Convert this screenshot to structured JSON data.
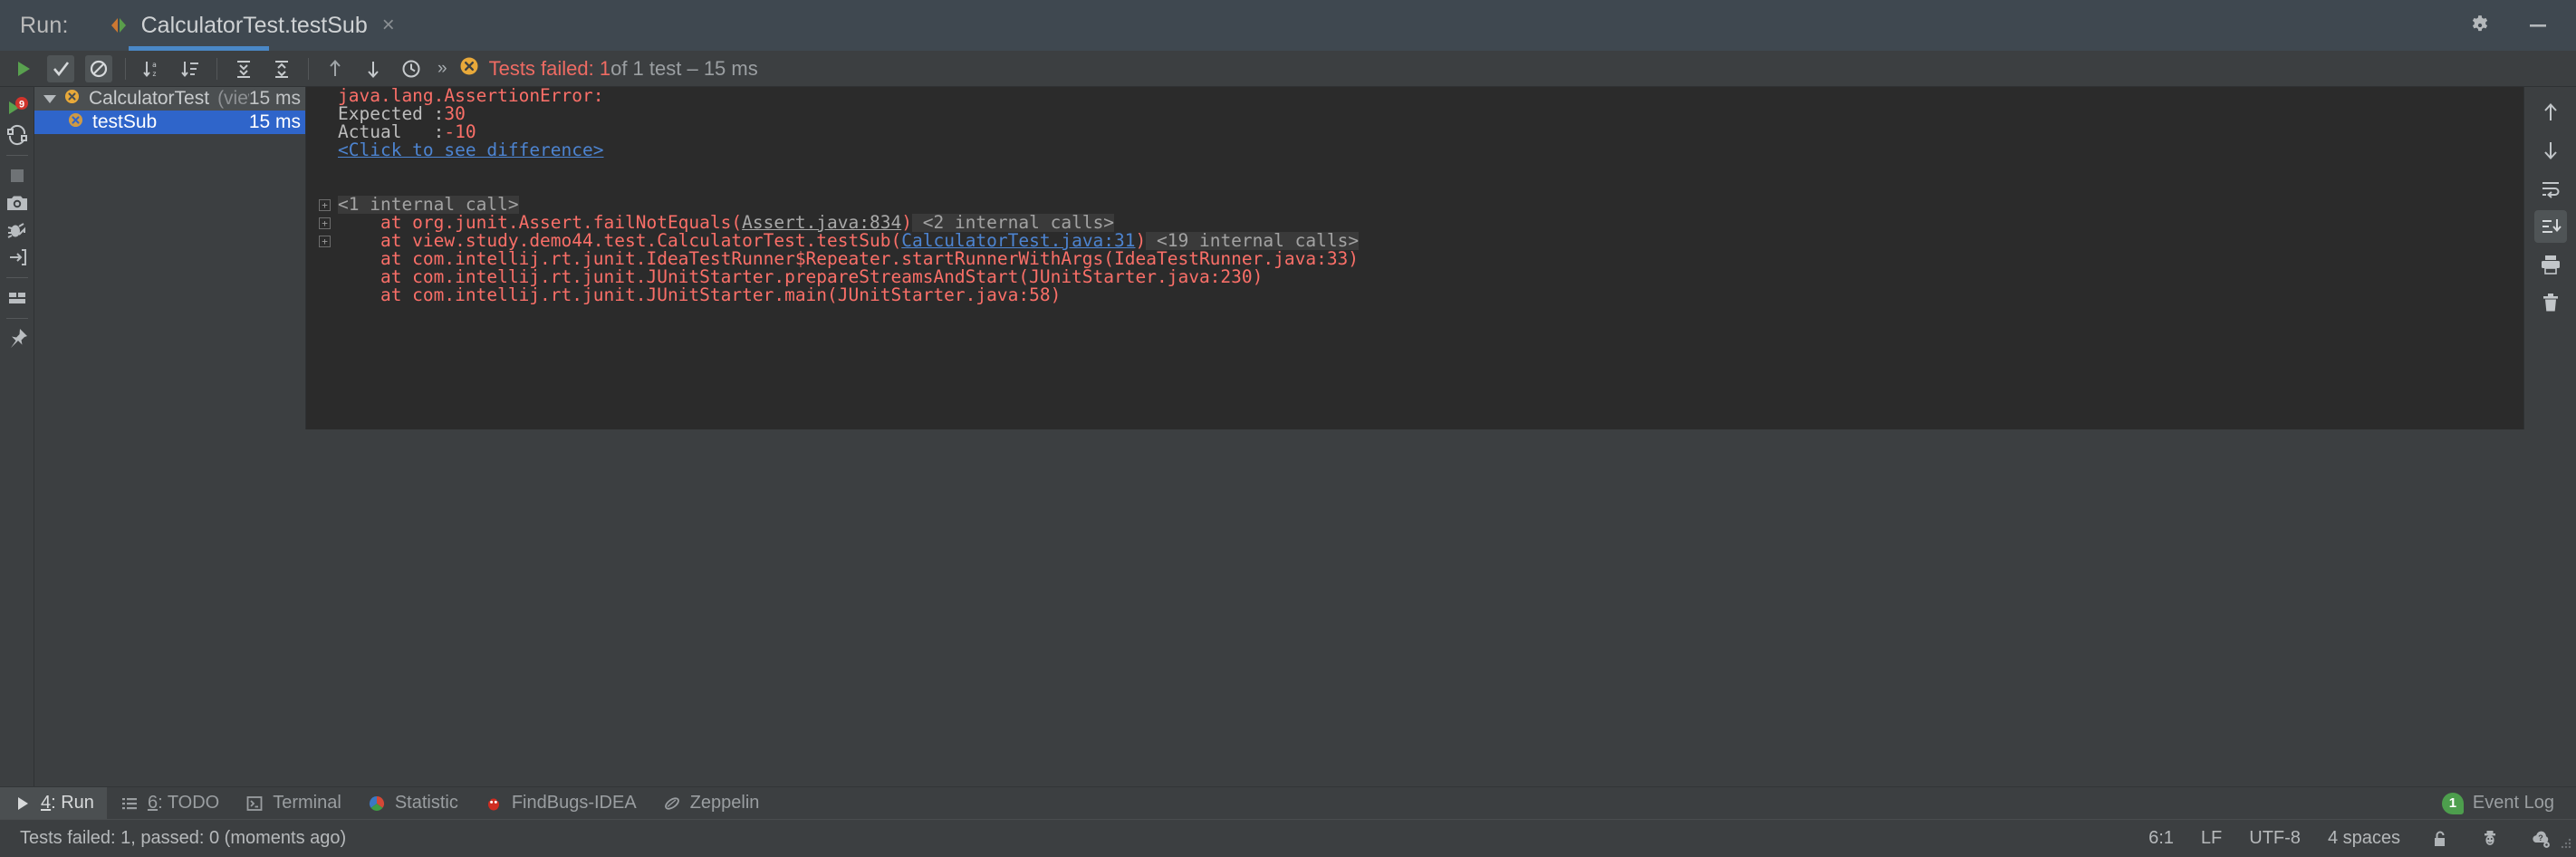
{
  "titlebar": {
    "run_label": "Run:",
    "tab_title": "CalculatorTest.testSub",
    "close_glyph": "×",
    "settings_icon": "gear-icon",
    "minimize_icon": "minimize-icon"
  },
  "toolbar": {
    "icons": [
      {
        "name": "rerun-tests-button",
        "label": "Rerun"
      },
      {
        "name": "show-passed-toggle",
        "label": "Show Passed"
      },
      {
        "name": "hide-ignored-toggle",
        "label": "Hide Ignored"
      },
      {
        "name": "sort-alphabetically-button",
        "label": "Sort Alphabetically"
      },
      {
        "name": "sort-by-duration-button",
        "label": "Sort by Duration"
      },
      {
        "name": "expand-all-button",
        "label": "Expand All"
      },
      {
        "name": "collapse-all-button",
        "label": "Collapse All"
      },
      {
        "name": "previous-failed-test-button",
        "label": "Previous Failed Test"
      },
      {
        "name": "next-failed-test-button",
        "label": "Next Failed Test"
      },
      {
        "name": "test-history-button",
        "label": "Test History"
      },
      {
        "name": "more-options-button",
        "label": "More"
      }
    ],
    "chevrons": "»",
    "status_fail": "Tests failed: 1",
    "status_rest": " of 1 test – 15 ms"
  },
  "left_gutter": {
    "icons": [
      {
        "name": "rerun-failed-tests-icon",
        "label": "Rerun Failed Tests"
      },
      {
        "name": "rerun-automatically-icon",
        "label": "Rerun Automatically"
      },
      {
        "name": "stop-icon",
        "label": "Stop"
      },
      {
        "name": "screenshot-icon",
        "label": "Screenshot"
      },
      {
        "name": "debug-icon",
        "label": "Debug"
      },
      {
        "name": "import-tests-icon",
        "label": "Import Test Results"
      },
      {
        "name": "layout-icon",
        "label": "Layout Settings"
      },
      {
        "name": "pin-tab-icon",
        "label": "Pin Tab"
      }
    ]
  },
  "tree": {
    "root": {
      "name": "CalculatorTest",
      "package": "(view.study.dem",
      "duration": "15 ms",
      "status": "failed"
    },
    "children": [
      {
        "name": "testSub",
        "duration": "15 ms",
        "status": "failed",
        "selected": true
      }
    ]
  },
  "console": {
    "lines": [
      {
        "id": "l1",
        "fold": false,
        "text": "java.lang.AssertionError:"
      },
      {
        "id": "l2",
        "fold": false,
        "text": "Expected :30"
      },
      {
        "id": "l3",
        "fold": false,
        "text": "Actual   :-10"
      },
      {
        "id": "l4",
        "fold": false,
        "text": "<Click to see difference>"
      },
      {
        "id": "l6",
        "fold": true,
        "text": "<1 internal call>"
      },
      {
        "id": "l7",
        "fold": true,
        "text": "    at org.junit.Assert.failNotEquals(Assert.java:834) <2 internal calls>"
      },
      {
        "id": "l8",
        "fold": true,
        "text": "    at view.study.demo44.test.CalculatorTest.testSub(CalculatorTest.java:31) <19 internal calls>"
      },
      {
        "id": "l9",
        "fold": false,
        "text": "    at com.intellij.rt.junit.IdeaTestRunner$Repeater.startRunnerWithArgs(IdeaTestRunner.java:33)"
      },
      {
        "id": "l10",
        "fold": false,
        "text": "    at com.intellij.rt.junit.JUnitStarter.prepareStreamsAndStart(JUnitStarter.java:230)"
      },
      {
        "id": "l11",
        "fold": false,
        "text": "    at com.intellij.rt.junit.JUnitStarter.main(JUnitStarter.java:58)"
      }
    ],
    "assertion_error": "java.lang.AssertionError:",
    "expected_label": "Expected :",
    "expected_value": "30",
    "actual_label": "Actual   :",
    "actual_value": "-10",
    "diff_link": "<Click to see difference>",
    "internal_call_1": "<1 internal call>",
    "frame2_prefix": "    at org.junit.Assert.failNotEquals(",
    "frame2_link": "Assert.java:834",
    "frame2_suffix": ")",
    "frame2_internal": " <2 internal calls>",
    "frame3_prefix": "    at view.study.demo44.test.CalculatorTest.testSub(",
    "frame3_link": "CalculatorTest.java:31",
    "frame3_suffix": ")",
    "frame3_internal": " <19 internal calls>",
    "frame4": "    at com.intellij.rt.junit.IdeaTestRunner$Repeater.startRunnerWithArgs(IdeaTestRunner.java:33)",
    "frame5": "    at com.intellij.rt.junit.JUnitStarter.prepareStreamsAndStart(JUnitStarter.java:230)",
    "frame6": "    at com.intellij.rt.junit.JUnitStarter.main(JUnitStarter.java:58)",
    "fold_glyph": "+"
  },
  "right_gutter": {
    "icons": [
      {
        "name": "scroll-up-icon",
        "label": "Up the Stack Trace"
      },
      {
        "name": "scroll-down-icon",
        "label": "Down the Stack Trace"
      },
      {
        "name": "soft-wrap-icon",
        "label": "Soft-Wrap"
      },
      {
        "name": "scroll-to-end-icon",
        "label": "Scroll to the End",
        "pressed": true
      },
      {
        "name": "print-icon",
        "label": "Print"
      },
      {
        "name": "clear-all-icon",
        "label": "Clear All"
      }
    ]
  },
  "bottom_tabs": {
    "tabs": [
      {
        "name": "tab-run",
        "num": "4",
        "label": ": Run",
        "icon": "play-icon",
        "active": true
      },
      {
        "name": "tab-todo",
        "num": "6",
        "label": ": TODO",
        "icon": "list-icon",
        "active": false
      },
      {
        "name": "tab-terminal",
        "num": "",
        "label": "Terminal",
        "icon": "terminal-icon",
        "active": false
      },
      {
        "name": "tab-statistic",
        "num": "",
        "label": "Statistic",
        "icon": "statistic-icon",
        "active": false
      },
      {
        "name": "tab-findbugs",
        "num": "",
        "label": "FindBugs-IDEA",
        "icon": "findbugs-icon",
        "active": false
      },
      {
        "name": "tab-zeppelin",
        "num": "",
        "label": "Zeppelin",
        "icon": "zeppelin-icon",
        "active": false
      }
    ],
    "event_log_count": "1",
    "event_log_label": "Event Log"
  },
  "statusbar": {
    "message": "Tests failed: 1, passed: 0 (moments ago)",
    "caret": "6:1",
    "line_separator": "LF",
    "encoding": "UTF-8",
    "indent": "4 spaces",
    "lock_icon": "unlock-icon",
    "hat_icon": "hector-inspector-icon",
    "cloud_icon": "cloud-question-icon"
  },
  "colors": {
    "accent_blue": "#2f65ca",
    "tab_underline": "#4a88c7",
    "fail_red": "#fa6f68",
    "fail_badge": "#e8a93a",
    "link_blue": "#4d84d1",
    "console_bg": "#2b2b2b",
    "panel_bg": "#3c3f41",
    "titlebar_bg": "#3f4850",
    "badge_green": "#4d9e4d"
  }
}
